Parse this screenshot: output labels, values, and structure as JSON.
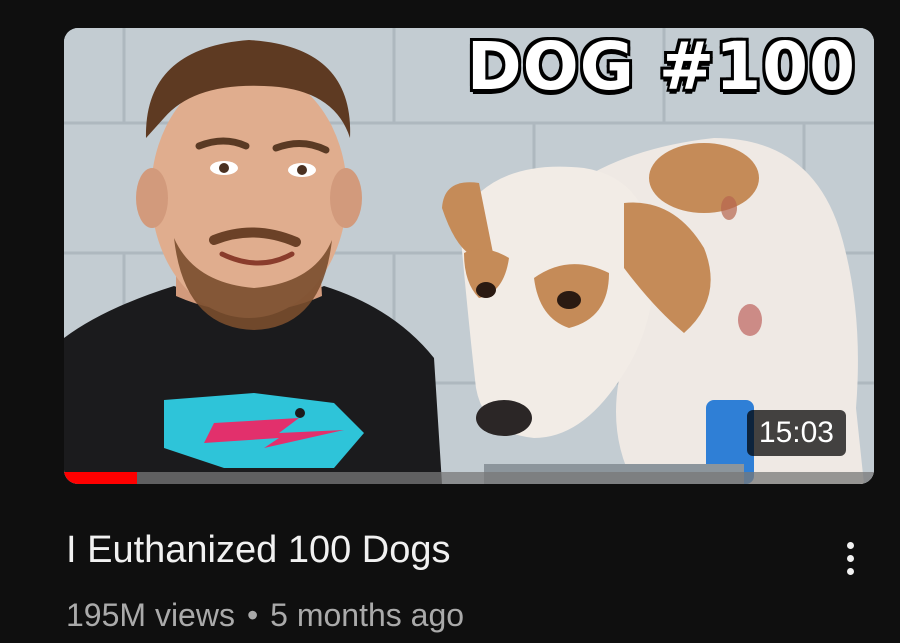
{
  "thumbnail": {
    "overlay_text": "DOG #100",
    "duration": "15:03",
    "watch_progress": 0.09,
    "colors": {
      "progress": "#ff0000",
      "shirt": "#1b1b1d",
      "logo_cyan": "#2ec4d9",
      "logo_pink": "#e2306c"
    }
  },
  "video": {
    "title": "I Euthanized 100 Dogs",
    "views": "195M views",
    "separator": "•",
    "age": "5 months ago"
  },
  "icons": {
    "menu": "more-vert-icon"
  }
}
